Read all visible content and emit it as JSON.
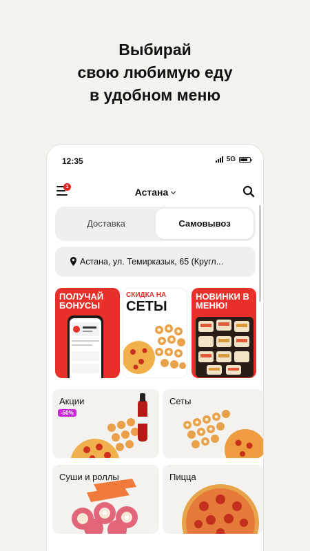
{
  "headline": [
    "Выбирай",
    "свою любимую еду",
    "в удобном меню"
  ],
  "status": {
    "time": "12:35",
    "network": "5G"
  },
  "appbar": {
    "city": "Астана",
    "notification_count": "1"
  },
  "delivery_mode": {
    "options": [
      "Доставка",
      "Самовывоз"
    ],
    "selected": "Самовывоз"
  },
  "address": "Астана, ул. Темирказык, 65 (Кругл...",
  "banners": [
    {
      "title": "ПОЛУЧАЙ БОНУСЫ"
    },
    {
      "title_top": "СКИДКА НА",
      "title_main": "СЕТЫ"
    },
    {
      "title": "НОВИНКИ В МЕНЮ!"
    }
  ],
  "categories": [
    {
      "label": "Акции",
      "badge": "-50%"
    },
    {
      "label": "Сеты"
    },
    {
      "label": "Суши и роллы"
    },
    {
      "label": "Пицца"
    }
  ],
  "colors": {
    "brand": "#e7302a",
    "sale": "#c626d4",
    "background": "#f4f2ef"
  }
}
